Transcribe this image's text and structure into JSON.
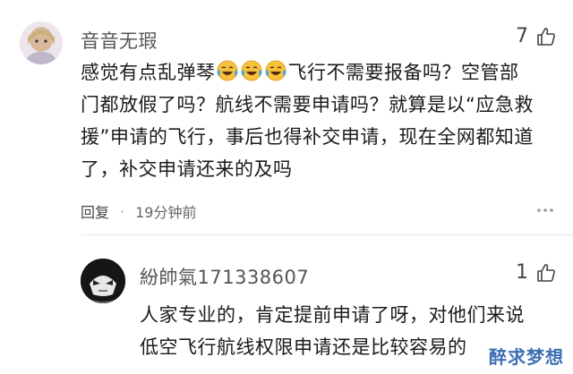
{
  "comments": [
    {
      "username": "音音无瑕",
      "likes": "7",
      "text_before_emoji": "感觉有点乱弹琴",
      "emoji_count": 3,
      "emoji_name": "laughing-tears-emoji",
      "text_line1_rest": "飞行不需要报备吗？空管部",
      "text_line2": "门都放假了吗？航线不需要申请吗？就算是以“应急救",
      "text_line3": "援”申请的飞行，事后也得补交申请，现在全网都知道",
      "text_line4": "了，补交申请还来的及吗",
      "reply_label": "回复",
      "time": "19分钟前"
    },
    {
      "username": "紛帥氣171338607",
      "likes": "1",
      "text_line1": "人家专业的，肯定提前申请了呀，对他们来说",
      "text_line2": "低空飞行航线权限申请还是比较容易的"
    }
  ],
  "watermark": "醉求梦想",
  "colors": {
    "text": "#1b1b1b",
    "username": "#555555",
    "meta": "#666666",
    "watermark": "#3d6fb5"
  }
}
